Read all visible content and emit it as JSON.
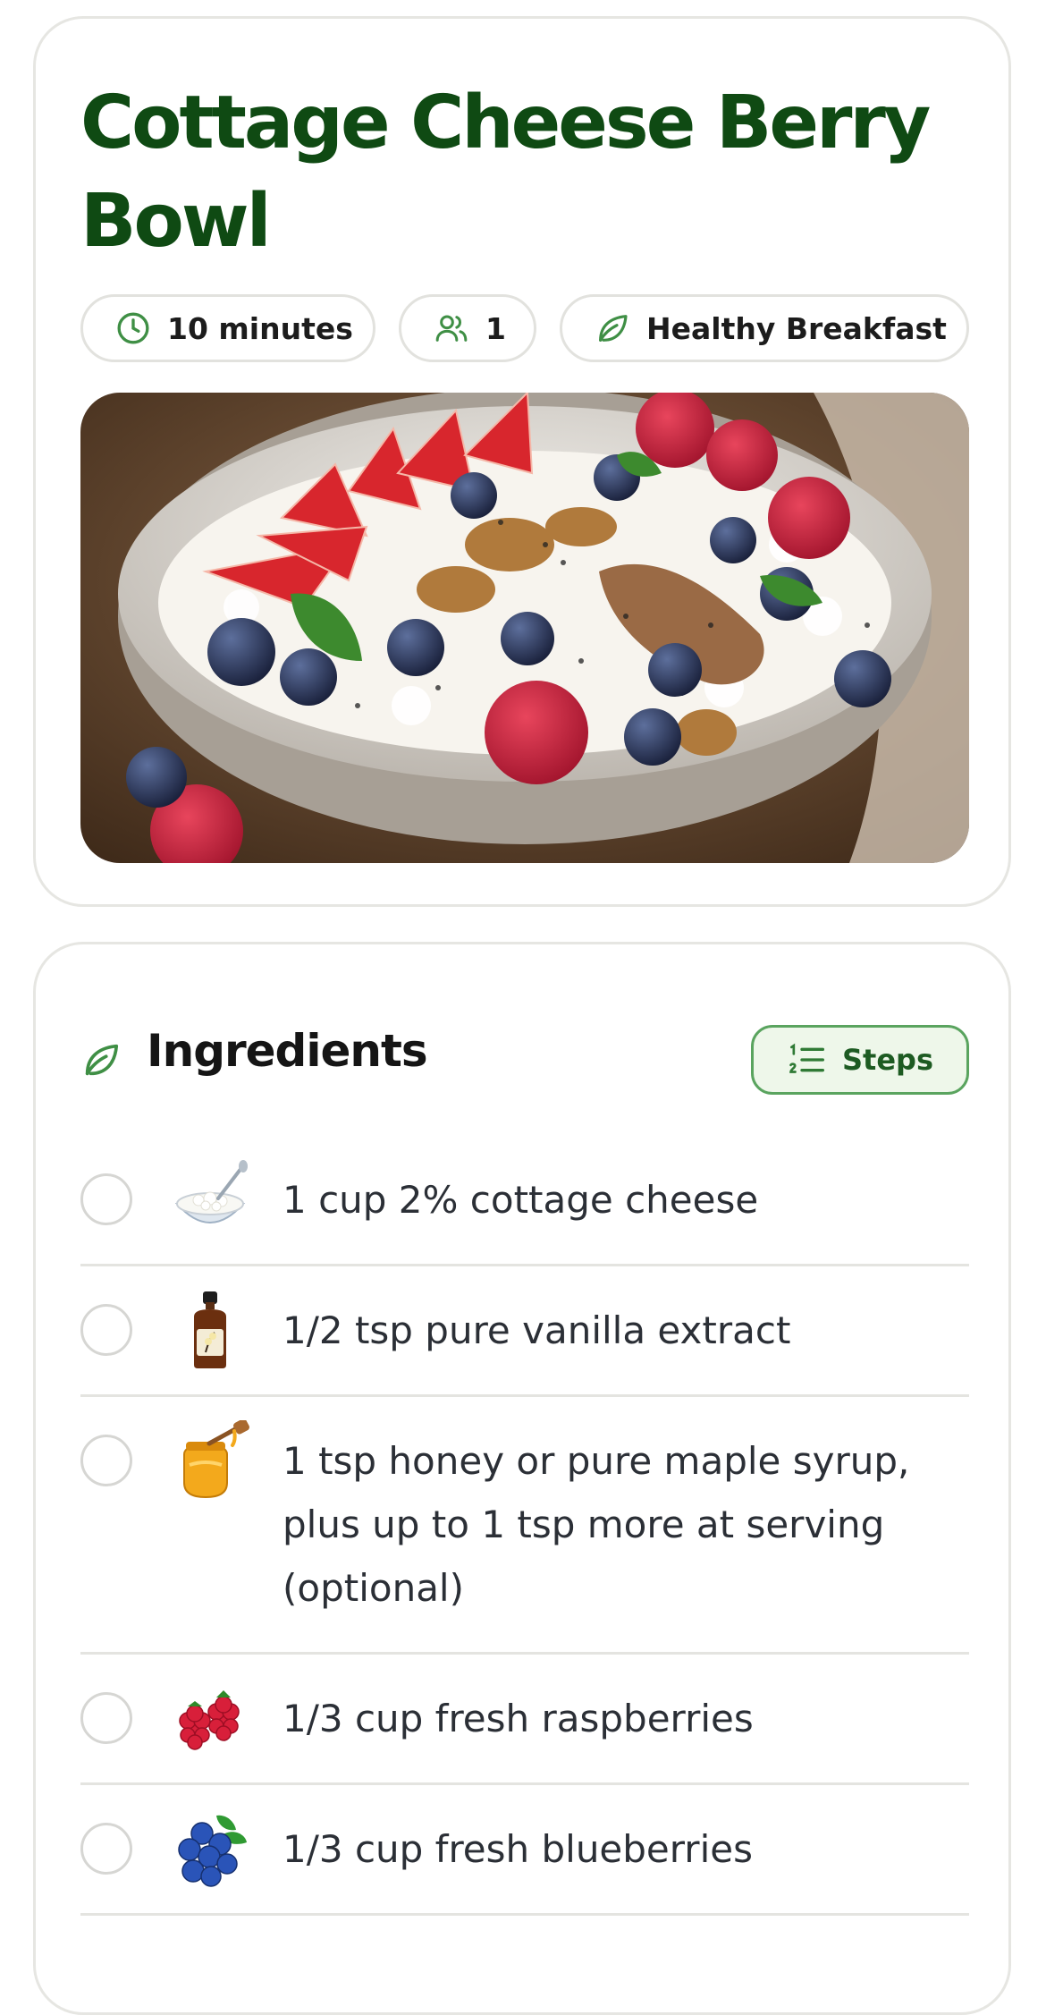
{
  "recipe": {
    "title": "Cottage Cheese Berry Bowl",
    "chips": {
      "time": "10 minutes",
      "servings": "1",
      "category": "Healthy Breakfast"
    },
    "photo_icon": "cottage-cheese-berry-bowl-photo"
  },
  "ingredients": {
    "heading": "Ingredients",
    "steps_button": "Steps",
    "items": [
      {
        "text": "1 cup 2% cottage cheese",
        "icon": "cottage-cheese-icon"
      },
      {
        "text": "1/2 tsp pure vanilla extract",
        "icon": "vanilla-extract-icon"
      },
      {
        "text": "1 tsp honey or pure maple syrup, plus up to 1 tsp more at serving (optional)",
        "icon": "honey-jar-icon"
      },
      {
        "text": "1/3 cup fresh raspberries",
        "icon": "raspberries-icon"
      },
      {
        "text": "1/3 cup fresh blueberries",
        "icon": "blueberries-icon"
      }
    ]
  },
  "colors": {
    "title_green": "#0f4a13",
    "accent_green": "#3f8f45",
    "steps_bg": "#eef7ea",
    "border": "#e4e4e0"
  }
}
